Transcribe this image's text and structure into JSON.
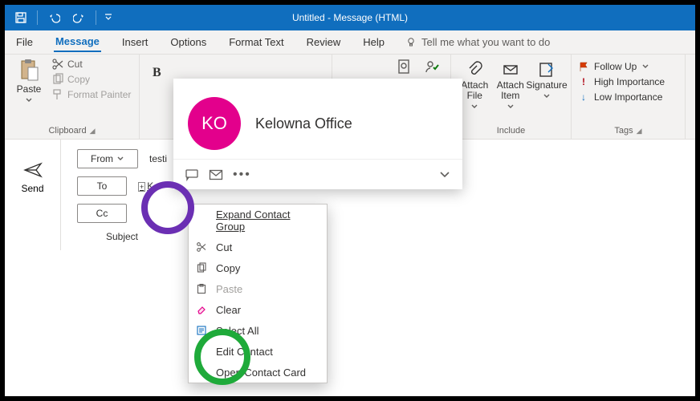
{
  "titlebar": {
    "title": "Untitled  -  Message (HTML)"
  },
  "menubar": {
    "file": "File",
    "message": "Message",
    "insert": "Insert",
    "options": "Options",
    "formattext": "Format Text",
    "review": "Review",
    "help": "Help",
    "tellme": "Tell me what you want to do"
  },
  "ribbon": {
    "clipboard": {
      "paste": "Paste",
      "cut": "Cut",
      "copy": "Copy",
      "formatpainter": "Format Painter",
      "label": "Clipboard"
    },
    "font": {
      "bold": "B"
    },
    "include": {
      "attachfile": "Attach File",
      "attachitem": "Attach Item",
      "signature": "Signature",
      "label": "Include"
    },
    "tags": {
      "followup": "Follow Up",
      "highimp": "High Importance",
      "lowimp": "Low Importance",
      "label": "Tags"
    }
  },
  "compose": {
    "send": "Send",
    "from": "From",
    "from_value": "testi",
    "to": "To",
    "to_entry": "K",
    "cc": "Cc",
    "subject": "Subject"
  },
  "contact_card": {
    "initials": "KO",
    "name": "Kelowna Office"
  },
  "context_menu": {
    "expand": "Expand Contact Group",
    "cut": "Cut",
    "copy": "Copy",
    "paste": "Paste",
    "clear": "Clear",
    "selectall": "Select All",
    "edit": "Edit Contact",
    "open": "Open Contact Card"
  }
}
